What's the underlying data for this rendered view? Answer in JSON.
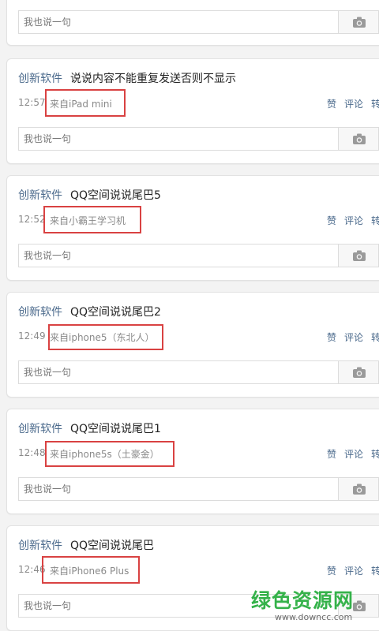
{
  "comment_placeholder": "我也说一句",
  "actions": {
    "like": "赞",
    "comment": "评论",
    "share": "转"
  },
  "posts": [
    {
      "author": "创新软件",
      "content": "说说内容不能重复发送否则不显示",
      "time": "12:57",
      "source": "来自iPad mini"
    },
    {
      "author": "创新软件",
      "content": "QQ空间说说尾巴5",
      "time": "12:52",
      "source": "来自小霸王学习机"
    },
    {
      "author": "创新软件",
      "content": "QQ空间说说尾巴2",
      "time": "12:49",
      "source": "来自iphone5（东北人）"
    },
    {
      "author": "创新软件",
      "content": "QQ空间说说尾巴1",
      "time": "12:48",
      "source": "来自iphone5s（土豪金）"
    },
    {
      "author": "创新软件",
      "content": "QQ空间说说尾巴",
      "time": "12:46",
      "source": "来自iPhone6 Plus"
    }
  ],
  "watermark": {
    "title": "绿色资源网",
    "url": "www.downcc.com"
  },
  "colors": {
    "author": "#4b6a8c",
    "highlight": "#d94242",
    "watermark": "#35b24a"
  }
}
